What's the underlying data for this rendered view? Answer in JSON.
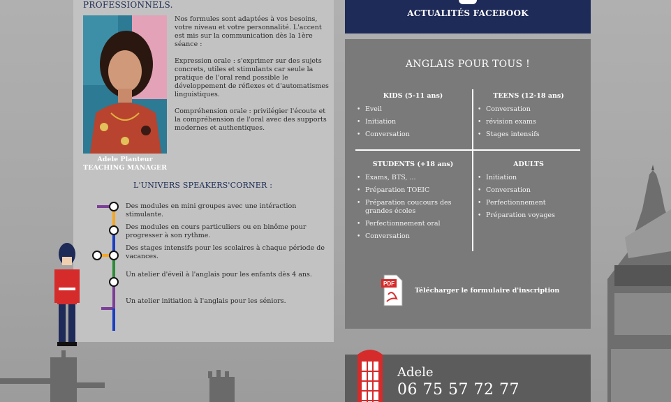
{
  "colors": {
    "navy": "#1e2a57",
    "grey_panel": "#7a7a7a",
    "left_panel": "#c2c2c2",
    "contact_panel": "#5c5c5c",
    "red": "#d62b2b"
  },
  "left": {
    "heading": "PROFESSIONNELS.",
    "intro": [
      "Nos formules sont adaptées à vos besoins, votre niveau et votre personnalité. L'accent est mis sur la communication dès la 1ère séance :",
      "Expression orale : s'exprimer sur des sujets concrets, utiles et stimulants car seule la pratique de l'oral rend possible le développement de réflexes et d'automatismes linguistiques.",
      "Compréhension orale : privilégier l'écoute et la compréhension de l'oral avec des supports modernes et authentiques."
    ],
    "photo_caption_name": "Adele Planteur",
    "photo_caption_role": "TEACHING MANAGER",
    "univers_title": "L'UNIVERS SPEAKERS'CORNER :",
    "metro_items": [
      "Des modules en mini groupes avec une intéraction stimulante.",
      "Des modules en cours particuliers ou en binôme pour progresser à son rythme.",
      "Des stages intensifs pour les scolaires à chaque période de vacances.",
      "Un atelier d'éveil à l'anglais pour les enfants dès 4 ans.",
      "Un atelier initiation à l'anglais pour les séniors."
    ]
  },
  "facebook": {
    "label": "ACTUALITÉS FACEBOOK"
  },
  "anglais": {
    "title": "ANGLAIS POUR TOUS !",
    "kids": {
      "title": "KIDS (5-11 ans)",
      "items": [
        "Eveil",
        "Initiation",
        "Conversation"
      ]
    },
    "teens": {
      "title": "TEENS (12-18 ans)",
      "items": [
        "Conversation",
        "révision exams",
        "Stages intensifs"
      ]
    },
    "students": {
      "title": "STUDENTS (+18 ans)",
      "items": [
        "Exams, BTS, ...",
        "Préparation TOEIC",
        "Préparation coucours des grandes écoles",
        "Perfectionnement oral",
        "Conversation"
      ]
    },
    "adults": {
      "title": "ADULTS",
      "items": [
        "Initiation",
        "Conversation",
        "Perfectionnement",
        "Préparation voyages"
      ]
    },
    "pdf_icon_text": "PDF",
    "pdf_label": "Télécharger le formulaire d'inscription"
  },
  "contact": {
    "name": "Adele",
    "phone": "06 75 57 72 77"
  }
}
